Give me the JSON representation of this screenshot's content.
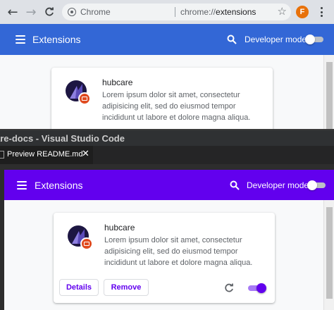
{
  "chrome": {
    "omnibox": {
      "chip": "Chrome",
      "url_scheme": "chrome://",
      "url_path": "extensions"
    },
    "profile_initial": "F",
    "header": {
      "title": "Extensions",
      "developer_mode_label": "Developer mode",
      "developer_mode_on": false,
      "accent": "#3367d6"
    },
    "card": {
      "name": "hubcare",
      "description": "Lorem ipsum dolor sit amet, consectetur adipisicing elit, sed do eiusmod tempor incididunt ut labore et dolore magna aliqua."
    }
  },
  "vscode": {
    "window_title": "are-docs - Visual Studio Code",
    "tab_label": "Preview README.md",
    "tab_close": "✕",
    "preview": {
      "header": {
        "title": "Extensions",
        "developer_mode_label": "Developer mode",
        "developer_mode_on": false,
        "accent": "#6200ee"
      },
      "card": {
        "name": "hubcare",
        "description": "Lorem ipsum dolor sit amet, consectetur adipisicing elit, sed do eiusmod tempor incididunt ut labore et dolore magna aliqua.",
        "details_label": "Details",
        "remove_label": "Remove",
        "enabled": true
      }
    }
  },
  "icons": {
    "back": "arrow-left-icon",
    "forward": "arrow-right-icon",
    "reload": "reload-icon",
    "menu": "hamburger-icon",
    "search": "search-icon",
    "star": "star-icon",
    "more": "kebab-menu-icon"
  }
}
